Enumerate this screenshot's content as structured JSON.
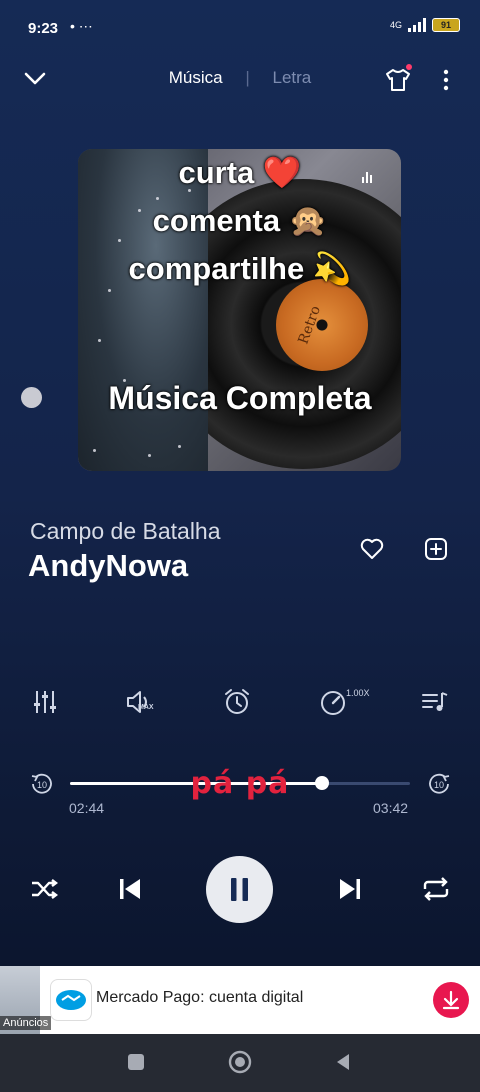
{
  "status_bar": {
    "time": "9:23",
    "icons": "• ⋯",
    "network": "4G",
    "battery": "91"
  },
  "header": {
    "tab_music": "Música",
    "tab_separator": "|",
    "tab_lyrics": "Letra",
    "tab_active": "Música"
  },
  "album_art": {
    "overlay_line1": "curta",
    "overlay_line1_emoji": "❤️",
    "overlay_line2": "comenta",
    "overlay_line2_emoji": "🙊",
    "overlay_line3": "compartilhe",
    "overlay_line3_emoji": "💫",
    "overlay_line4": "Música Completa",
    "record_label": "Retro"
  },
  "song": {
    "title": "Campo de Batalha",
    "artist": "AndyNowa"
  },
  "tools": {
    "equalizer": "equalizer-icon",
    "volume_max_label": "MAX",
    "timer": "alarm-icon",
    "speed_label": "1.00X",
    "queue": "playlist-icon"
  },
  "progress": {
    "current_time": "02:44",
    "total_time": "03:42",
    "fraction": 0.74,
    "lyric_overlay": "pá pá",
    "rewind_label": "10",
    "forward_label": "10"
  },
  "controls": {
    "shuffle": "shuffle-icon",
    "previous": "previous-icon",
    "state": "playing",
    "next": "next-icon",
    "repeat": "repeat-icon"
  },
  "ad": {
    "badge": "Anúncios",
    "text": "Mercado Pago: cuenta digital"
  },
  "colors": {
    "accent_red": "#e2223e",
    "ad_download": "#e8174f",
    "background_top": "#152a55",
    "background_bottom": "#0a1228"
  }
}
